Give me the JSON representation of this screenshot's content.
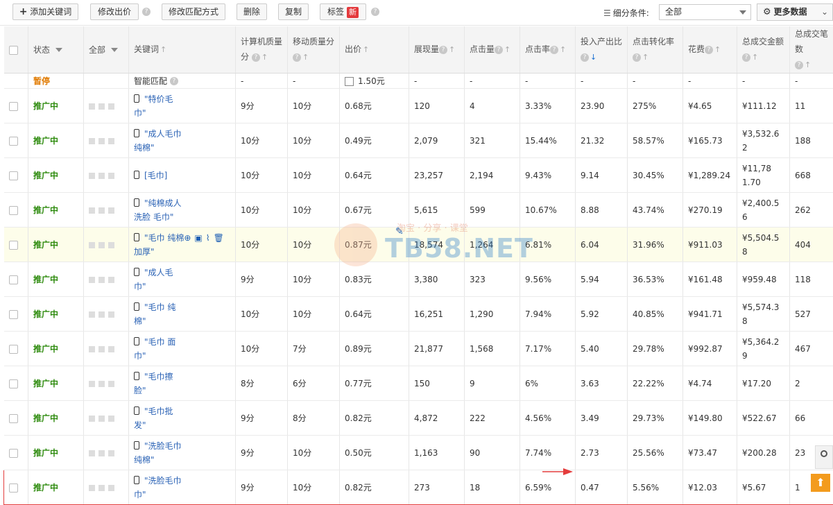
{
  "toolbar": {
    "add_keyword": "添加关键词",
    "modify_bid": "修改出价",
    "modify_match": "修改匹配方式",
    "delete": "删除",
    "copy": "复制",
    "tag": "标签",
    "new_badge": "新",
    "filter_label": "细分条件:",
    "filter_value": "全部",
    "more_data": "更多数据"
  },
  "table": {
    "headers": {
      "status": "状态",
      "all": "全部",
      "keyword": "关键词",
      "pc_quality": "计算机质量分",
      "mobile_quality": "移动质量分",
      "bid": "出价",
      "impressions": "展现量",
      "clicks": "点击量",
      "ctr": "点击率",
      "roi": "投入产出比",
      "cvr": "点击转化率",
      "cost": "花费",
      "gmv": "总成交金额",
      "orders": "总成交笔数"
    },
    "smart_row": {
      "status": "暂停",
      "keyword": "智能匹配",
      "pc_quality": "-",
      "mobile_quality": "-",
      "bid": "1.50元",
      "impressions": "-",
      "clicks": "-",
      "ctr": "-",
      "roi": "-",
      "cvr": "-",
      "cost": "-",
      "gmv": "-",
      "orders": "-"
    },
    "rows": [
      {
        "status": "推广中",
        "kw1": "\"特价毛",
        "kw2": "巾\"",
        "pcq": "9分",
        "mq": "10分",
        "bid": "0.68元",
        "imp": "120",
        "clk": "4",
        "ctr": "3.33%",
        "roi": "23.90",
        "cvr": "275%",
        "cost": "¥4.65",
        "gmv1": "¥111.12",
        "gmv2": "",
        "ord": "11"
      },
      {
        "status": "推广中",
        "kw1": "\"成人毛巾",
        "kw2": "纯棉\"",
        "pcq": "10分",
        "mq": "10分",
        "bid": "0.49元",
        "imp": "2,079",
        "clk": "321",
        "ctr": "15.44%",
        "roi": "21.32",
        "cvr": "58.57%",
        "cost": "¥165.73",
        "gmv1": "¥3,532.6",
        "gmv2": "2",
        "ord": "188"
      },
      {
        "status": "推广中",
        "kw1": "[毛巾]",
        "kw2": "",
        "pcq": "10分",
        "mq": "10分",
        "bid": "0.64元",
        "imp": "23,257",
        "clk": "2,194",
        "ctr": "9.43%",
        "roi": "9.14",
        "cvr": "30.45%",
        "cost": "¥1,289.24",
        "gmv1": "¥11,78",
        "gmv2": "1.70",
        "ord": "668"
      },
      {
        "status": "推广中",
        "kw1": "\"纯棉成人",
        "kw2": "洗脸 毛巾\"",
        "pcq": "10分",
        "mq": "10分",
        "bid": "0.67元",
        "imp": "5,615",
        "clk": "599",
        "ctr": "10.67%",
        "roi": "8.88",
        "cvr": "43.74%",
        "cost": "¥270.19",
        "gmv1": "¥2,400.5",
        "gmv2": "6",
        "ord": "262"
      },
      {
        "status": "推广中",
        "kw1": "\"毛巾 纯棉",
        "kw2": "加厚\"",
        "pcq": "10分",
        "mq": "10分",
        "bid": "0.87元",
        "imp": "18,574",
        "clk": "1,264",
        "ctr": "6.81%",
        "roi": "6.04",
        "cvr": "31.96%",
        "cost": "¥911.03",
        "gmv1": "¥5,504.5",
        "gmv2": "8",
        "ord": "404"
      },
      {
        "status": "推广中",
        "kw1": "\"成人毛",
        "kw2": "巾\"",
        "pcq": "9分",
        "mq": "10分",
        "bid": "0.83元",
        "imp": "3,380",
        "clk": "323",
        "ctr": "9.56%",
        "roi": "5.94",
        "cvr": "36.53%",
        "cost": "¥161.48",
        "gmv1": "¥959.48",
        "gmv2": "",
        "ord": "118"
      },
      {
        "status": "推广中",
        "kw1": "\"毛巾 纯",
        "kw2": "棉\"",
        "pcq": "10分",
        "mq": "10分",
        "bid": "0.64元",
        "imp": "16,251",
        "clk": "1,290",
        "ctr": "7.94%",
        "roi": "5.92",
        "cvr": "40.85%",
        "cost": "¥941.71",
        "gmv1": "¥5,574.3",
        "gmv2": "8",
        "ord": "527"
      },
      {
        "status": "推广中",
        "kw1": "\"毛巾 面",
        "kw2": "巾\"",
        "pcq": "10分",
        "mq": "7分",
        "bid": "0.89元",
        "imp": "21,877",
        "clk": "1,568",
        "ctr": "7.17%",
        "roi": "5.40",
        "cvr": "29.78%",
        "cost": "¥992.87",
        "gmv1": "¥5,364.2",
        "gmv2": "9",
        "ord": "467"
      },
      {
        "status": "推广中",
        "kw1": "\"毛巾擦",
        "kw2": "脸\"",
        "pcq": "8分",
        "mq": "6分",
        "bid": "0.77元",
        "imp": "150",
        "clk": "9",
        "ctr": "6%",
        "roi": "3.63",
        "cvr": "22.22%",
        "cost": "¥4.74",
        "gmv1": "¥17.20",
        "gmv2": "",
        "ord": "2"
      },
      {
        "status": "推广中",
        "kw1": "\"毛巾批",
        "kw2": "发\"",
        "pcq": "9分",
        "mq": "8分",
        "bid": "0.82元",
        "imp": "4,872",
        "clk": "222",
        "ctr": "4.56%",
        "roi": "3.49",
        "cvr": "29.73%",
        "cost": "¥149.80",
        "gmv1": "¥522.67",
        "gmv2": "",
        "ord": "66"
      },
      {
        "status": "推广中",
        "kw1": "\"洗脸毛巾",
        "kw2": "纯棉\"",
        "pcq": "9分",
        "mq": "10分",
        "bid": "0.50元",
        "imp": "1,163",
        "clk": "90",
        "ctr": "7.74%",
        "roi": "2.73",
        "cvr": "25.56%",
        "cost": "¥73.47",
        "gmv1": "¥200.28",
        "gmv2": "",
        "ord": "23"
      },
      {
        "status": "推广中",
        "kw1": "\"洗脸毛巾",
        "kw2": "巾\"",
        "pcq": "9分",
        "mq": "10分",
        "bid": "0.82元",
        "imp": "273",
        "clk": "18",
        "ctr": "6.59%",
        "roi": "0.47",
        "cvr": "5.56%",
        "cost": "¥12.03",
        "gmv1": "¥5.67",
        "gmv2": "",
        "ord": "1"
      }
    ]
  },
  "watermark": {
    "brand": "TB58.NET",
    "slogan": "淘宝 · 分享 · 课堂"
  },
  "colors": {
    "status_running": "#2e8b0e",
    "status_paused": "#e07a00",
    "keyword_link": "#2a62b5",
    "highlight_row": "#fdfdea",
    "outline": "#e43c3c"
  }
}
